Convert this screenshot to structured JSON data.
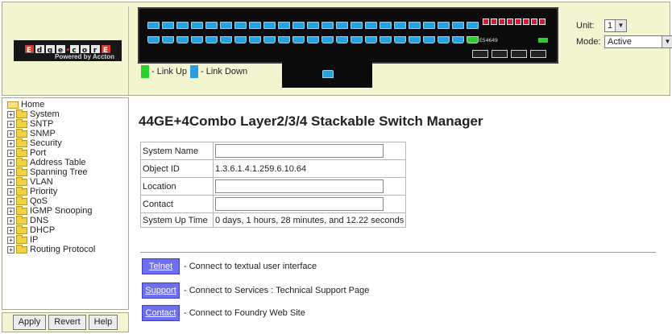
{
  "header": {
    "logo_letters": [
      "E",
      "d",
      "g",
      "e",
      "c",
      "o",
      "r",
      "E"
    ],
    "logo_tagline": "Powered by Accton",
    "device_model": "ES4649",
    "legend": {
      "up_label": "- Link Up",
      "down_label": "- Link Down"
    },
    "unit": {
      "label": "Unit:",
      "value": "1"
    },
    "mode": {
      "label": "Mode:",
      "value": "Active"
    },
    "colors": {
      "link_up": "#2bd22b",
      "link_down": "#2a9ee0",
      "header_bg": "#f2f5d0"
    }
  },
  "nav": {
    "home": "Home",
    "items": [
      "System",
      "SNTP",
      "SNMP",
      "Security",
      "Port",
      "Address Table",
      "Spanning Tree",
      "VLAN",
      "Priority",
      "QoS",
      "IGMP Snooping",
      "DNS",
      "DHCP",
      "IP",
      "Routing Protocol"
    ],
    "buttons": {
      "apply": "Apply",
      "revert": "Revert",
      "help": "Help"
    }
  },
  "main": {
    "title": "44GE+4Combo Layer2/3/4 Stackable Switch Manager",
    "fields": {
      "system_name": "System Name",
      "object_id_label": "Object ID",
      "object_id_value": "1.3.6.1.4.1.259.6.10.64",
      "location": "Location",
      "contact": "Contact",
      "uptime_label": "System Up Time",
      "uptime_value": "0 days, 1 hours, 28 minutes, and 12.22 seconds"
    },
    "links": [
      {
        "button": "Telnet",
        "text": "- Connect to textual user interface"
      },
      {
        "button": "Support",
        "text": "- Connect to Services : Technical Support Page"
      },
      {
        "button": "Contact",
        "text": "- Connect to Foundry Web Site"
      }
    ]
  }
}
